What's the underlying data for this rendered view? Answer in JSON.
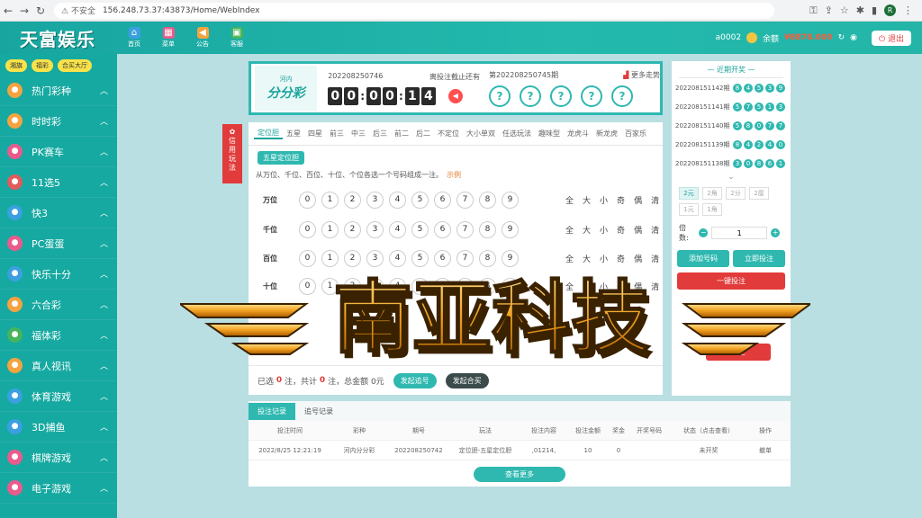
{
  "browser": {
    "url_warning": "不安全",
    "url": "156.248.73.37:43873/Home/WebIndex",
    "profile_initial": "R"
  },
  "topbar": {
    "logo": "天富娱乐",
    "nav": [
      {
        "label": "首页"
      },
      {
        "label": "菜单"
      },
      {
        "label": "公告"
      },
      {
        "label": "客服"
      }
    ],
    "username": "a0002",
    "balance_label": "余额",
    "balance": "¥8878.000",
    "logout": "退出"
  },
  "sidebar": {
    "quick": [
      "湘旗",
      "福彩",
      "合买大厅"
    ],
    "items": [
      {
        "label": "热门彩种",
        "color": "#f4a340"
      },
      {
        "label": "时时彩",
        "color": "#f4a340"
      },
      {
        "label": "PK赛车",
        "color": "#e95b8c"
      },
      {
        "label": "11选5",
        "color": "#e05b5b"
      },
      {
        "label": "快3",
        "color": "#3aa0e0"
      },
      {
        "label": "PC蛋蛋",
        "color": "#e95b8c"
      },
      {
        "label": "快乐十分",
        "color": "#3aa0e0"
      },
      {
        "label": "六合彩",
        "color": "#f4a340"
      },
      {
        "label": "福体彩",
        "color": "#46b45a"
      },
      {
        "label": "真人视讯",
        "color": "#f4a340"
      },
      {
        "label": "体育游戏",
        "color": "#3aa0e0"
      },
      {
        "label": "3D捕鱼",
        "color": "#3aa0e0"
      },
      {
        "label": "棋牌游戏",
        "color": "#e95b8c"
      },
      {
        "label": "电子游戏",
        "color": "#e95b8c"
      }
    ]
  },
  "panel": {
    "logo_small": "河内",
    "logo_big": "分分彩",
    "current_issue": "202208250746",
    "deadline_label": "离投注截止还有",
    "countdown": [
      "0",
      "0",
      "0",
      "0",
      "1",
      "4"
    ],
    "result_issue": "第202208250745期",
    "trend": "更多走势",
    "result_balls": [
      "?",
      "?",
      "?",
      "?",
      "?"
    ]
  },
  "badge": "信用玩法",
  "bet": {
    "tabs": [
      "定位胆",
      "五星",
      "四星",
      "前三",
      "中三",
      "后三",
      "前二",
      "后二",
      "不定位",
      "大小单双",
      "任选玩法",
      "趣味型",
      "龙虎斗",
      "新龙虎",
      "百家乐"
    ],
    "subtab": "五星定位胆",
    "rule": "从万位、千位、百位、十位、个位各选一个号码组成一注。",
    "rule_example": "示例",
    "rows": [
      {
        "label": "万位"
      },
      {
        "label": "千位"
      },
      {
        "label": "百位"
      },
      {
        "label": "十位"
      }
    ],
    "numbers": [
      "0",
      "1",
      "2",
      "3",
      "4",
      "5",
      "6",
      "7",
      "8",
      "9"
    ],
    "quick_picks": [
      "全",
      "大",
      "小",
      "奇",
      "偶",
      "清"
    ],
    "footer_selected": "已选",
    "footer_count": "0",
    "footer_count_unit": "注，共计",
    "footer_total": "0",
    "footer_total_unit": "注，总金额",
    "footer_amount": "0元",
    "btn_chase": "发起追号",
    "btn_join": "发起合买"
  },
  "right": {
    "head": "近期开奖",
    "draws": [
      {
        "no": "202208151142期",
        "balls": [
          "8",
          "4",
          "5",
          "3",
          "9"
        ]
      },
      {
        "no": "202208151141期",
        "balls": [
          "5",
          "7",
          "5",
          "1",
          "3"
        ]
      },
      {
        "no": "202208151140期",
        "balls": [
          "5",
          "8",
          "0",
          "7",
          "7"
        ]
      },
      {
        "no": "202208151139期",
        "balls": [
          "8",
          "4",
          "2",
          "4",
          "0"
        ]
      },
      {
        "no": "202208151138期",
        "balls": [
          "3",
          "0",
          "8",
          "6",
          "1"
        ]
      }
    ],
    "units": [
      "2元",
      "2角",
      "2分",
      "2厘",
      "1元",
      "1角"
    ],
    "multiple_label": "倍数:",
    "multiple_value": "1",
    "btn_add": "添加号码",
    "btn_bet": "立即投注",
    "btn_one_click": "一键投注",
    "btn_clear": "清空"
  },
  "records": {
    "tabs": [
      "投注记录",
      "追号记录"
    ],
    "headers": [
      "投注时间",
      "彩种",
      "期号",
      "玩法",
      "投注内容",
      "投注金额",
      "奖金",
      "开奖号码",
      "状态（点击查看）",
      "操作"
    ],
    "rows": [
      [
        "2022/8/25 12:21:19",
        "河内分分彩",
        "202208250742",
        "定位胆-五星定位胆",
        ",01214,",
        "10",
        "0",
        "",
        "未开奖",
        "撤单"
      ]
    ],
    "more": "查看更多"
  },
  "watermark": "南亚科技"
}
